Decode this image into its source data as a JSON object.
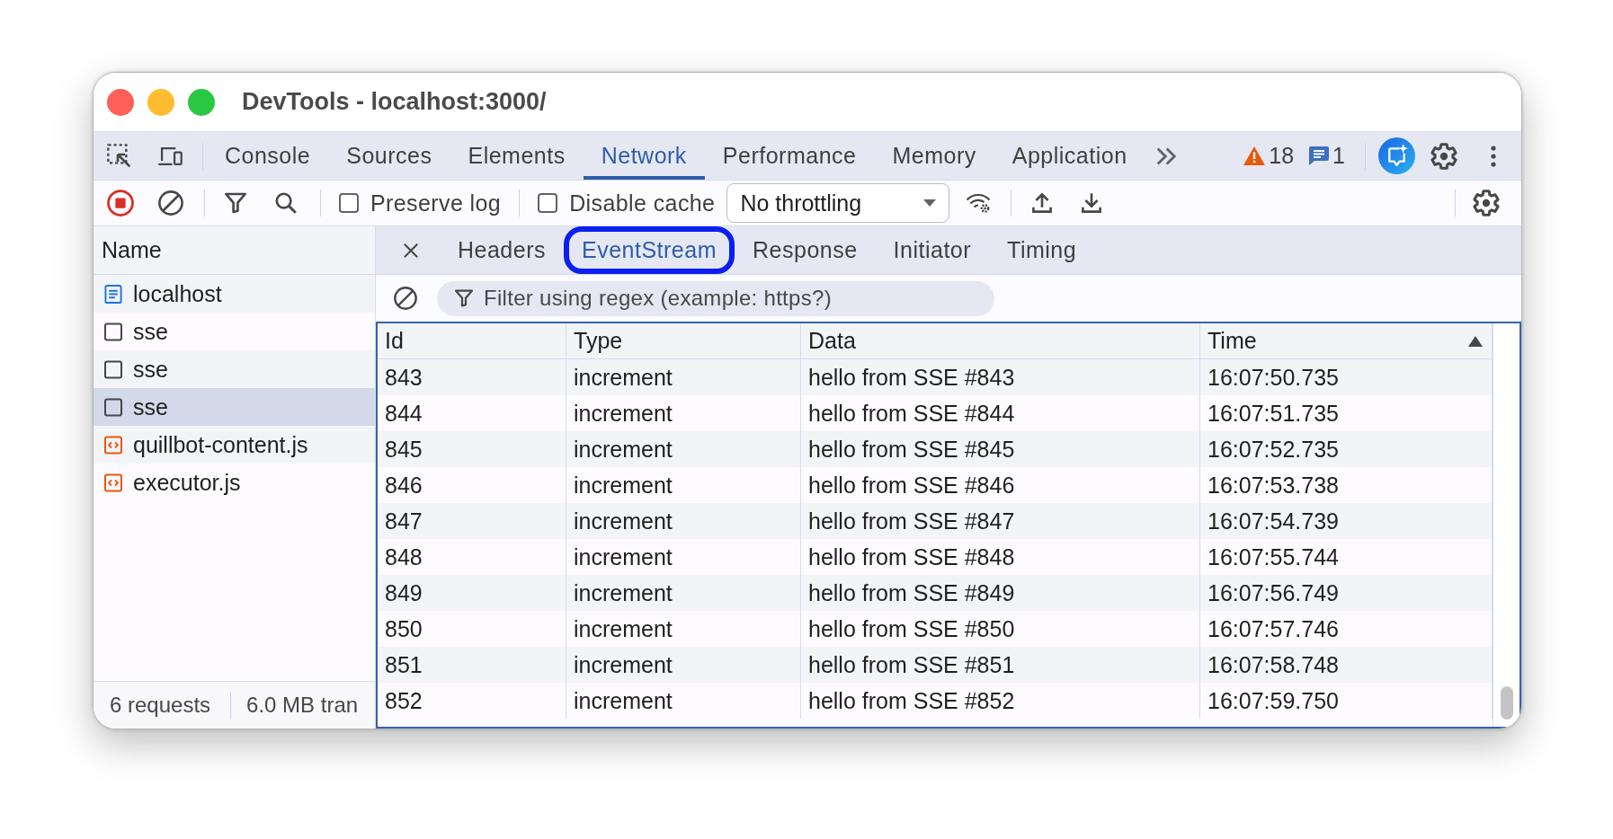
{
  "window": {
    "title": "DevTools - localhost:3000/"
  },
  "main_tabs": [
    {
      "label": "Console",
      "selected": false
    },
    {
      "label": "Sources",
      "selected": false
    },
    {
      "label": "Elements",
      "selected": false
    },
    {
      "label": "Network",
      "selected": true
    },
    {
      "label": "Performance",
      "selected": false
    },
    {
      "label": "Memory",
      "selected": false
    },
    {
      "label": "Application",
      "selected": false
    }
  ],
  "counters": {
    "warnings": "18",
    "messages": "1"
  },
  "toolbar": {
    "recording": true,
    "preserve_log": {
      "label": "Preserve log",
      "checked": false
    },
    "disable_cache": {
      "label": "Disable cache",
      "checked": false
    },
    "throttling": {
      "value": "No throttling"
    }
  },
  "requests": {
    "header": "Name",
    "items": [
      {
        "name": "localhost",
        "kind": "document",
        "selected": false
      },
      {
        "name": "sse",
        "kind": "eventsource",
        "selected": false
      },
      {
        "name": "sse",
        "kind": "eventsource",
        "selected": false
      },
      {
        "name": "sse",
        "kind": "eventsource",
        "selected": true
      },
      {
        "name": "quillbot-content.js",
        "kind": "script",
        "selected": false
      },
      {
        "name": "executor.js",
        "kind": "script",
        "selected": false
      }
    ],
    "summary": [
      "6 requests",
      "6.0 MB tran"
    ]
  },
  "detail_tabs": [
    {
      "label": "Headers",
      "selected": false,
      "highlighted": false
    },
    {
      "label": "EventStream",
      "selected": true,
      "highlighted": true
    },
    {
      "label": "Response",
      "selected": false,
      "highlighted": false
    },
    {
      "label": "Initiator",
      "selected": false,
      "highlighted": false
    },
    {
      "label": "Timing",
      "selected": false,
      "highlighted": false
    }
  ],
  "filter": {
    "placeholder": "Filter using regex (example: https?)"
  },
  "table": {
    "columns": [
      {
        "label": "Id",
        "sorted_ascending": false
      },
      {
        "label": "Type",
        "sorted_ascending": false
      },
      {
        "label": "Data",
        "sorted_ascending": false
      },
      {
        "label": "Time",
        "sorted_ascending": true
      }
    ],
    "rows": [
      {
        "id": "843",
        "type": "increment",
        "data": "hello from SSE #843",
        "time": "16:07:50.735"
      },
      {
        "id": "844",
        "type": "increment",
        "data": "hello from SSE #844",
        "time": "16:07:51.735"
      },
      {
        "id": "845",
        "type": "increment",
        "data": "hello from SSE #845",
        "time": "16:07:52.735"
      },
      {
        "id": "846",
        "type": "increment",
        "data": "hello from SSE #846",
        "time": "16:07:53.738"
      },
      {
        "id": "847",
        "type": "increment",
        "data": "hello from SSE #847",
        "time": "16:07:54.739"
      },
      {
        "id": "848",
        "type": "increment",
        "data": "hello from SSE #848",
        "time": "16:07:55.744"
      },
      {
        "id": "849",
        "type": "increment",
        "data": "hello from SSE #849",
        "time": "16:07:56.749"
      },
      {
        "id": "850",
        "type": "increment",
        "data": "hello from SSE #850",
        "time": "16:07:57.746"
      },
      {
        "id": "851",
        "type": "increment",
        "data": "hello from SSE #851",
        "time": "16:07:58.748"
      },
      {
        "id": "852",
        "type": "increment",
        "data": "hello from SSE #852",
        "time": "16:07:59.750"
      }
    ]
  }
}
